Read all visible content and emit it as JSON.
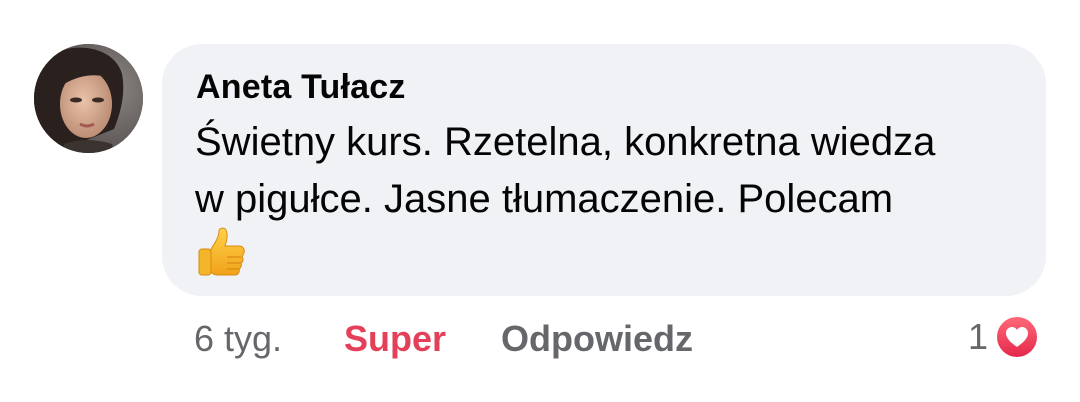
{
  "comment": {
    "author": "Aneta Tułacz",
    "text_lines": [
      "Świetny kurs. Rzetelna, konkretna wiedza",
      "w pigułce. Jasne tłumaczenie. Polecam"
    ],
    "emoji": "thumbs-up-icon"
  },
  "actions": {
    "time": "6 tyg.",
    "reaction_label": "Super",
    "reply_label": "Odpowiedz",
    "reaction_count": "1",
    "reaction_icon": "heart-icon"
  },
  "colors": {
    "bubble_bg": "#f0f2f5",
    "reaction_red": "#e4405a",
    "secondary_text": "#65676b"
  }
}
